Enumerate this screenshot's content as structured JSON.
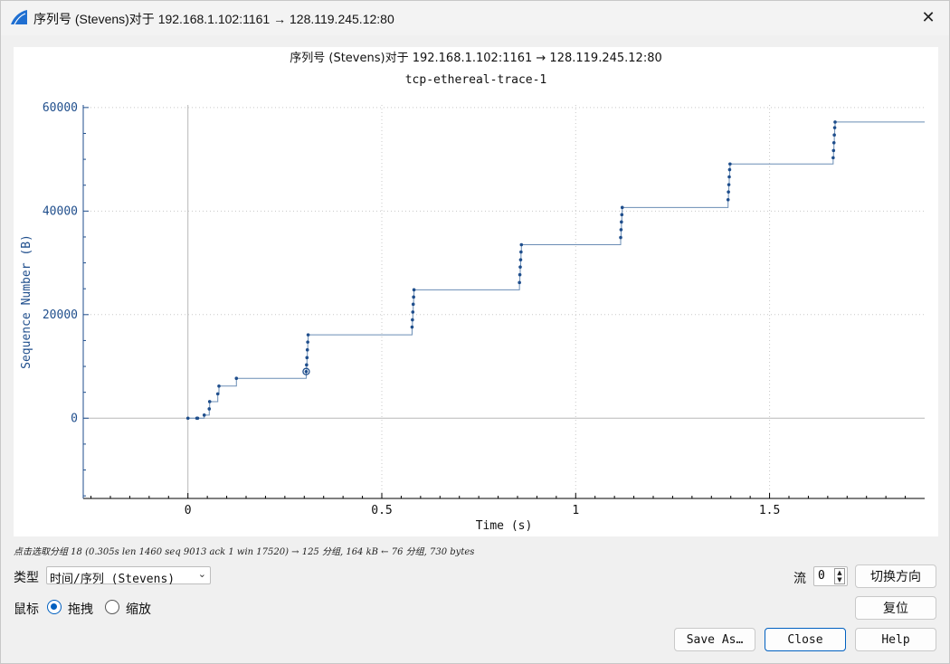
{
  "window": {
    "title": "序列号 (Stevens)对于 192.168.1.102:1161 → 128.119.245.12:80",
    "icon": "wireshark-fin-icon",
    "close_glyph": "✕"
  },
  "chart_data": {
    "type": "line",
    "title": "序列号 (Stevens)对于 192.168.1.102:1161 → 128.119.245.12:80",
    "subtitle": "tcp-ethereal-trace-1",
    "xlabel": "Time (s)",
    "ylabel": "Sequence Number (B)",
    "xlim": [
      -0.27,
      1.9
    ],
    "ylim": [
      -15500,
      60500
    ],
    "xticks": [
      0,
      0.5,
      1,
      1.5
    ],
    "xtick_labels": [
      "0",
      "0.5",
      "1",
      "1.5"
    ],
    "yticks": [
      0,
      20000,
      40000,
      60000
    ],
    "ytick_labels": [
      "0",
      "20000",
      "40000",
      "60000"
    ],
    "grid": true,
    "color": "#1f4e8c",
    "selected_point": {
      "x": 0.305,
      "y": 9013
    },
    "series": [
      {
        "values": [
          [
            0,
            0
          ],
          [
            0.023,
            0
          ],
          [
            0.025,
            0
          ],
          [
            0.042,
            600
          ],
          [
            0.055,
            1800
          ],
          [
            0.056,
            3200
          ],
          [
            0.077,
            4700
          ],
          [
            0.08,
            6200
          ],
          [
            0.125,
            7700
          ],
          [
            0.305,
            9000
          ],
          [
            0.306,
            10300
          ],
          [
            0.307,
            11700
          ],
          [
            0.308,
            13200
          ],
          [
            0.309,
            14700
          ],
          [
            0.31,
            16100
          ],
          [
            0.578,
            17600
          ],
          [
            0.579,
            19000
          ],
          [
            0.58,
            20500
          ],
          [
            0.581,
            22000
          ],
          [
            0.582,
            23400
          ],
          [
            0.583,
            24800
          ],
          [
            0.855,
            26200
          ],
          [
            0.856,
            27700
          ],
          [
            0.857,
            29200
          ],
          [
            0.858,
            30600
          ],
          [
            0.859,
            32100
          ],
          [
            0.86,
            33500
          ],
          [
            1.116,
            34900
          ],
          [
            1.117,
            36400
          ],
          [
            1.118,
            37900
          ],
          [
            1.119,
            39300
          ],
          [
            1.12,
            40700
          ],
          [
            1.393,
            42200
          ],
          [
            1.394,
            43700
          ],
          [
            1.395,
            45100
          ],
          [
            1.396,
            46600
          ],
          [
            1.397,
            48000
          ],
          [
            1.398,
            49100
          ],
          [
            1.664,
            50300
          ],
          [
            1.665,
            51700
          ],
          [
            1.666,
            53200
          ],
          [
            1.667,
            54700
          ],
          [
            1.668,
            56100
          ],
          [
            1.669,
            57200
          ]
        ],
        "tail_x": 1.9
      }
    ]
  },
  "status": {
    "text": "点击选取分组 18 (0.305s len 1460 seq 9013 ack 1 win 17520) → 125 分组, 164 kB ← 76 分组, 730 bytes"
  },
  "controls": {
    "type_label": "类型",
    "type_value": "时间/序列 (Stevens)",
    "chevron_icon": "chevron-down-icon",
    "mouse_label": "鼠标",
    "drag_label": "拖拽",
    "zoom_label": "缩放",
    "drag_selected": true,
    "stream_label": "流",
    "stream_value": "0",
    "switch_direction": "切换方向",
    "reset": "复位",
    "save_as": "Save As…",
    "close": "Close",
    "help": "Help"
  }
}
